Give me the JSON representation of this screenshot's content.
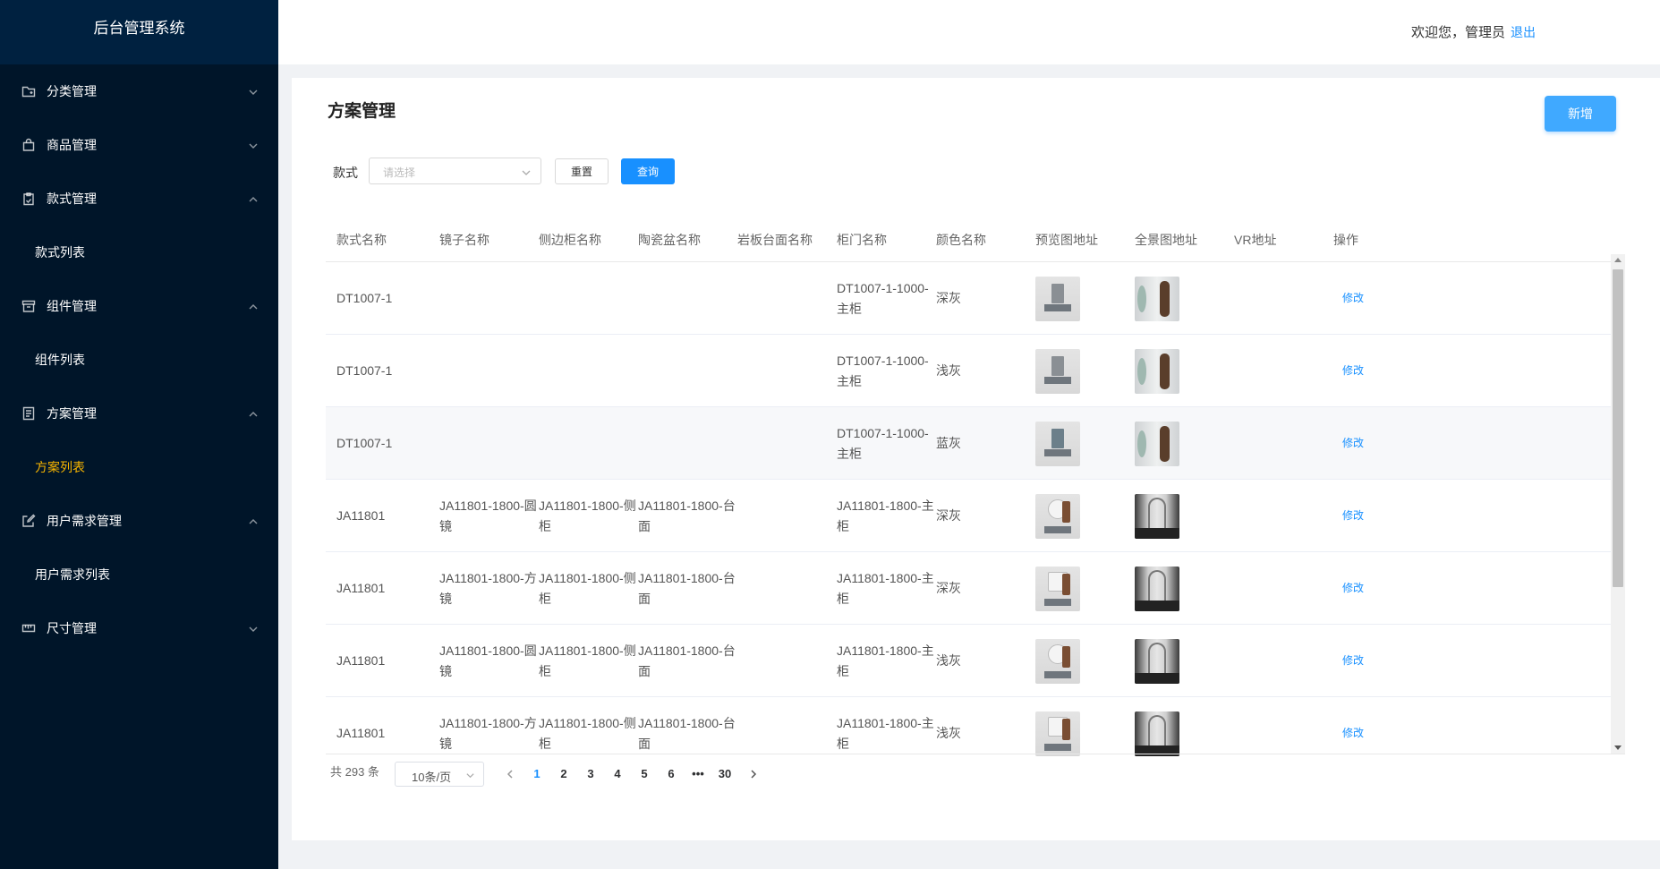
{
  "app": {
    "title": "后台管理系统"
  },
  "header": {
    "welcome": "欢迎您，管理员",
    "logout": "退出"
  },
  "sidebar": {
    "items": [
      {
        "label": "分类管理",
        "icon": "folder-icon",
        "expanded": false
      },
      {
        "label": "商品管理",
        "icon": "shopping-bag-icon",
        "expanded": false
      },
      {
        "label": "款式管理",
        "icon": "clipboard-icon",
        "expanded": true,
        "children": [
          "款式列表"
        ]
      },
      {
        "label": "组件管理",
        "icon": "archive-icon",
        "expanded": true,
        "children": [
          "组件列表"
        ]
      },
      {
        "label": "方案管理",
        "icon": "document-icon",
        "expanded": true,
        "children": [
          "方案列表"
        ]
      },
      {
        "label": "用户需求管理",
        "icon": "edit-icon",
        "expanded": true,
        "children": [
          "用户需求列表"
        ]
      },
      {
        "label": "尺寸管理",
        "icon": "ruler-icon",
        "expanded": false
      }
    ],
    "active_child": "方案列表"
  },
  "page": {
    "title": "方案管理",
    "add_button": "新增",
    "filter": {
      "label": "款式",
      "placeholder": "请选择",
      "reset": "重置",
      "query": "查询"
    }
  },
  "table": {
    "columns": [
      "款式名称",
      "镜子名称",
      "侧边柜名称",
      "陶瓷盆名称",
      "岩板台面名称",
      "柜门名称",
      "颜色名称",
      "预览图地址",
      "全景图地址",
      "VR地址",
      "操作"
    ],
    "rows": [
      {
        "style": "DT1007-1",
        "mirror": "",
        "side": "",
        "basin": "",
        "slab": "",
        "door": "DT1007-1-1000-主柜",
        "color": "深灰",
        "action": "修改"
      },
      {
        "style": "DT1007-1",
        "mirror": "",
        "side": "",
        "basin": "",
        "slab": "",
        "door": "DT1007-1-1000-主柜",
        "color": "浅灰",
        "action": "修改"
      },
      {
        "style": "DT1007-1",
        "mirror": "",
        "side": "",
        "basin": "",
        "slab": "",
        "door": "DT1007-1-1000-主柜",
        "color": "蓝灰",
        "action": "修改"
      },
      {
        "style": "JA11801",
        "mirror": "JA11801-1800-圆镜",
        "side": "JA11801-1800-侧柜",
        "basin": "JA11801-1800-台面",
        "slab": "",
        "door": "JA11801-1800-主柜",
        "color": "深灰",
        "action": "修改"
      },
      {
        "style": "JA11801",
        "mirror": "JA11801-1800-方镜",
        "side": "JA11801-1800-侧柜",
        "basin": "JA11801-1800-台面",
        "slab": "",
        "door": "JA11801-1800-主柜",
        "color": "深灰",
        "action": "修改"
      },
      {
        "style": "JA11801",
        "mirror": "JA11801-1800-圆镜",
        "side": "JA11801-1800-侧柜",
        "basin": "JA11801-1800-台面",
        "slab": "",
        "door": "JA11801-1800-主柜",
        "color": "浅灰",
        "action": "修改"
      },
      {
        "style": "JA11801",
        "mirror": "JA11801-1800-方镜",
        "side": "JA11801-1800-侧柜",
        "basin": "JA11801-1800-台面",
        "slab": "",
        "door": "JA11801-1800-主柜",
        "color": "浅灰",
        "action": "修改"
      }
    ]
  },
  "pagination": {
    "total": "共 293 条",
    "page_size": "10条/页",
    "pages": [
      "1",
      "2",
      "3",
      "4",
      "5",
      "6",
      "•••",
      "30"
    ],
    "current": "1"
  },
  "colors": {
    "sidebar_bg": "#001529",
    "active_menu": "#f7b500",
    "primary": "#1890ff"
  }
}
